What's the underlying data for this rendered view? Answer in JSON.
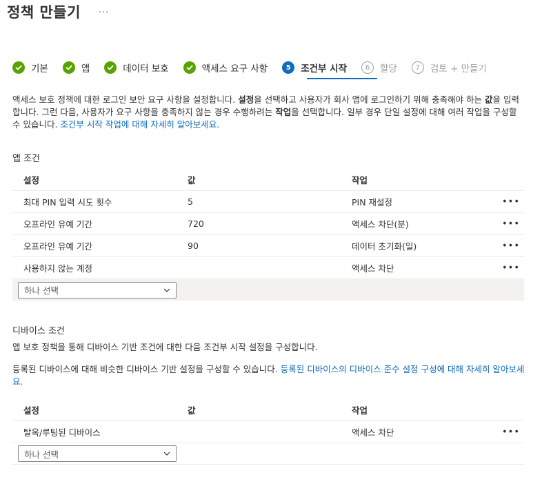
{
  "page": {
    "title": "정책 만들기",
    "more": "···"
  },
  "wizard": {
    "steps": [
      {
        "label": "기본",
        "status": "done"
      },
      {
        "label": "앱",
        "status": "done"
      },
      {
        "label": "데이터 보호",
        "status": "done"
      },
      {
        "label": "액세스 요구 사항",
        "status": "done"
      },
      {
        "label": "조건부 시작",
        "status": "current",
        "number": "5"
      },
      {
        "label": "할당",
        "status": "todo",
        "number": "6"
      },
      {
        "label": "검토 + 만들기",
        "status": "todo",
        "number": "7"
      }
    ]
  },
  "intro": {
    "p1": "액세스 보호 정책에 대한 로그인 보안 요구 사항을 설정합니다. ",
    "b1": "설정",
    "p2": "을 선택하고 사용자가 회사 앱에 로그인하기 위해 충족해야 하는 ",
    "b2": "값",
    "p3": "을 입력합니다. 그런 다음, 사용자가 요구 사항을 충족하지 않는 경우 수행하려는 ",
    "b3": "작업",
    "p4": "을 선택합니다. 일부 경우 단일 설정에 대해 여러 작업을 구성할 수 있습니다. ",
    "link": "조건부 시작 작업에 대해 자세히 알아보세요."
  },
  "app_conditions": {
    "title": "앱 조건",
    "headers": {
      "setting": "설정",
      "value": "값",
      "action": "작업"
    },
    "rows": [
      {
        "setting": "최대 PIN 입력 시도 횟수",
        "value": "5",
        "action": "PIN 재설정"
      },
      {
        "setting": "오프라인 유예 기간",
        "value": "720",
        "action": "액세스 차단(분)"
      },
      {
        "setting": "오프라인 유예 기간",
        "value": "90",
        "action": "데이터 초기화(일)"
      },
      {
        "setting": "사용하지 않는 계정",
        "value": "",
        "action": "액세스 차단"
      }
    ],
    "select_placeholder": "하나 선택"
  },
  "device_conditions": {
    "title": "디바이스 조건",
    "desc1": "앱 보호 정책을 통해 디바이스 기반 조건에 대한 다음 조건부 시작 설정을 구성합니다.",
    "desc2": "등록된 디바이스에 대해 비슷한 디바이스 기반 설정을 구성할 수 있습니다. ",
    "desc2_link": "등록된 디바이스의 디바이스 준수 설정 구성에 대해 자세히 알아보세요.",
    "headers": {
      "setting": "설정",
      "value": "값",
      "action": "작업"
    },
    "rows": [
      {
        "setting": "탈옥/루팅된 디바이스",
        "value": "",
        "action": "액세스 차단"
      }
    ],
    "select_placeholder": "하나 선택"
  },
  "row_more": "•••",
  "colors": {
    "accent": "#0f6cbd",
    "success": "#57a300",
    "muted": "#a19f9d"
  }
}
